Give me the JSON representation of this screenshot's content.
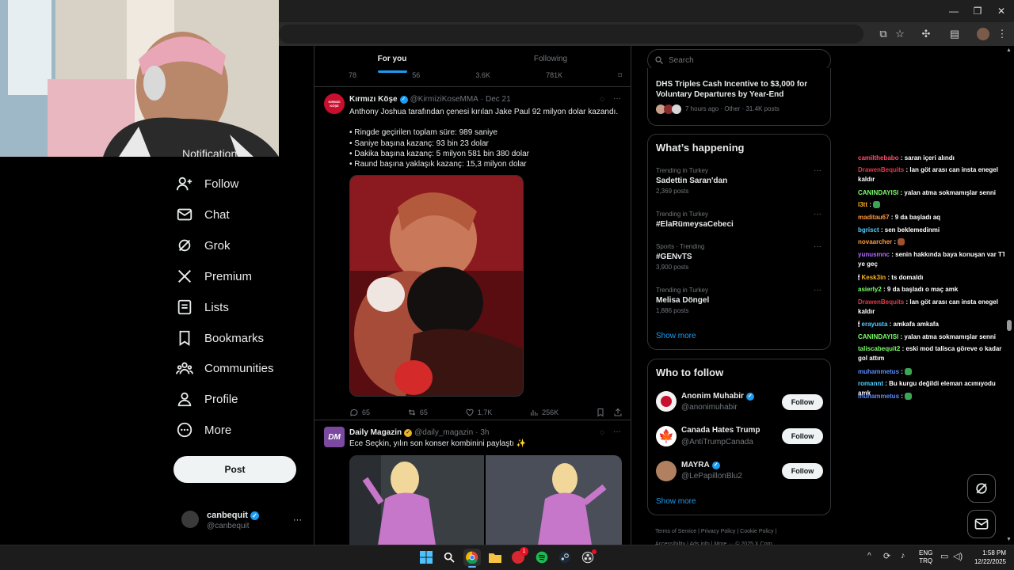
{
  "browser": {
    "minimize_icon": "minimize-icon",
    "maximize_icon": "maximize-icon",
    "close_icon": "close-icon"
  },
  "nav": {
    "partial_item": "Notifications",
    "items": [
      {
        "label": "Follow",
        "icon": "person-plus-icon"
      },
      {
        "label": "Chat",
        "icon": "mail-icon"
      },
      {
        "label": "Grok",
        "icon": "grok-icon"
      },
      {
        "label": "Premium",
        "icon": "x-logo-icon"
      },
      {
        "label": "Lists",
        "icon": "list-icon"
      },
      {
        "label": "Bookmarks",
        "icon": "bookmark-icon"
      },
      {
        "label": "Communities",
        "icon": "communities-icon"
      },
      {
        "label": "Profile",
        "icon": "person-icon"
      },
      {
        "label": "More",
        "icon": "more-circle-icon"
      }
    ],
    "post_label": "Post",
    "account": {
      "name": "canbequit",
      "handle": "@canbequit",
      "more": "···"
    }
  },
  "tabs": {
    "for_you": "For you",
    "following": "Following"
  },
  "prev_tweet_stats": {
    "replies": "78",
    "retweets": "56",
    "likes": "3.6K",
    "views": "781K"
  },
  "tweets": [
    {
      "avatar_text": "KIRMIZI KÖŞE",
      "author": "Kırmızı Köşe",
      "handle": "@KirmiziKoseMMA",
      "date": "· Dec 21",
      "more": "···",
      "text_lines": [
        "Anthony Joshua tarafından çenesi kırılan Jake Paul 92 milyon dolar kazandı.",
        "",
        "• Ringde geçirilen toplam süre: 989 saniye",
        "• Saniye başına kazanç: 93 bin 23 dolar",
        "• Dakika başına kazanç: 5 milyon 581 bin 380 dolar",
        "• Raund başına yaklaşık kazanç: 15,3 milyon dolar"
      ],
      "stats": {
        "replies": "65",
        "retweets": "65",
        "likes": "1.7K",
        "views": "256K"
      }
    },
    {
      "avatar_text": "DM",
      "author": "Daily Magazin",
      "handle": "@daily_magazin",
      "date": "· 3h",
      "more": "···",
      "text": "Ece Seçkin, yılın son konser kombinini paylaştı ✨"
    }
  ],
  "search": {
    "placeholder": "Search"
  },
  "news": {
    "title": "DHS Triples Cash Incentive to $3,000 for Voluntary Departures by Year-End",
    "meta": "7 hours ago · Other · 31.4K posts"
  },
  "whats_happening": {
    "title": "What’s happening",
    "trends": [
      {
        "context": "Trending in Turkey",
        "name": "Sadettin Saran'dan",
        "posts": "2,369 posts"
      },
      {
        "context": "Trending in Turkey",
        "name": "#ElaRümeysaCebeci",
        "posts": ""
      },
      {
        "context": "Sports · Trending",
        "name": "#GENvTS",
        "posts": "3,900 posts"
      },
      {
        "context": "Trending in Turkey",
        "name": "Melisa Döngel",
        "posts": "1,886 posts"
      }
    ],
    "show_more": "Show more"
  },
  "who_to_follow": {
    "title": "Who to follow",
    "accounts": [
      {
        "name": "Anonim Muhabir",
        "handle": "@anonimuhabir",
        "verified": true
      },
      {
        "name": "Canada Hates Trump",
        "handle": "@AntiTrumpCanada",
        "verified": false
      },
      {
        "name": "MAYRA",
        "handle": "@LePapillonBlu2",
        "verified": true
      }
    ],
    "follow_label": "Follow",
    "show_more": "Show more"
  },
  "footer": {
    "links": [
      "Terms of Service",
      "Privacy Policy",
      "Cookie Policy",
      "Accessibility",
      "Ads info",
      "More ···",
      "© 2025 X Corp."
    ]
  },
  "chat": [
    {
      "user": "camilthebabo",
      "color": "#ff4d6d",
      "text": "saran içeri alındı"
    },
    {
      "user": "DrawenBequits",
      "color": "#e0394a",
      "text": "lan göt arası can insta enegel kaldır"
    },
    {
      "user": "CANINDAYISI",
      "color": "#7cfc6a",
      "text": "yalan atma sokmamışlar senni"
    },
    {
      "user": "l3tt",
      "color": "#ffb020",
      "text": ""
    },
    {
      "user": "maditau67",
      "color": "#ff9a3c",
      "text": "9 da başladı aq"
    },
    {
      "user": "bgrisct",
      "color": "#52d0ff",
      "text": "sen beklemedinmi"
    },
    {
      "user": "novaarcher",
      "color": "#ff9a3c",
      "text": ""
    },
    {
      "user": "yunusmnc",
      "color": "#b36bff",
      "text": "senin hakkında baya konuşan var TT ye geç"
    },
    {
      "user": "Kesk3in",
      "color": "#ffb020",
      "text": "ts domaldı"
    },
    {
      "user": "asierly2",
      "color": "#7cfc6a",
      "text": "9 da başladı o maç amk"
    },
    {
      "user": "DrawenBequits",
      "color": "#e0394a",
      "text": "lan göt arası can insta enegel kaldır"
    },
    {
      "user": "erayusta",
      "color": "#52d0ff",
      "text": "amkafa amkafa"
    },
    {
      "user": "CANINDAYISI",
      "color": "#7cfc6a",
      "text": "yalan atma sokmamışlar senni"
    },
    {
      "user": "taliscabequit2",
      "color": "#7cfc6a",
      "text": "eski mod taliscа göreve o kadar gol attım"
    },
    {
      "user": "muhammetus",
      "color": "#5b8cff",
      "text": ""
    },
    {
      "user": "romannt",
      "color": "#52d0ff",
      "text": "Bu kurgu değildi eleman acımıyodu amk"
    },
    {
      "user": "muhammetus",
      "color": "#5b8cff",
      "text": ""
    }
  ],
  "floating": {
    "grok_icon": "grok-icon",
    "messages_icon": "mail-icon"
  },
  "taskbar": {
    "apps": [
      "windows-start-icon",
      "search-icon",
      "chrome-icon",
      "file-explorer-icon",
      "game-app-icon",
      "spotify-icon",
      "steam-icon",
      "obs-icon"
    ],
    "badge": "1",
    "lang_top": "ENG",
    "lang_bottom": "TRQ",
    "time": "1:58 PM",
    "date": "12/22/2025"
  },
  "colors": {
    "accent": "#1d9bf0",
    "background": "#000000",
    "verified": "#1d9bf0",
    "gold": "#e8b32c"
  }
}
